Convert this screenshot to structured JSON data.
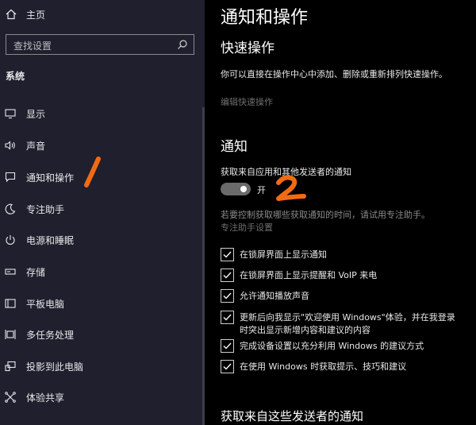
{
  "sidebar": {
    "home_label": "主页",
    "search_placeholder": "查找设置",
    "section_title": "系统",
    "items": [
      {
        "label": "显示",
        "icon": "monitor-icon"
      },
      {
        "label": "声音",
        "icon": "speaker-icon"
      },
      {
        "label": "通知和操作",
        "icon": "notification-icon"
      },
      {
        "label": "专注助手",
        "icon": "moon-icon"
      },
      {
        "label": "电源和睡眠",
        "icon": "power-icon"
      },
      {
        "label": "存储",
        "icon": "storage-icon"
      },
      {
        "label": "平板电脑",
        "icon": "tablet-icon"
      },
      {
        "label": "多任务处理",
        "icon": "multitask-icon"
      },
      {
        "label": "投影到此电脑",
        "icon": "project-icon"
      },
      {
        "label": "体验共享",
        "icon": "share-icon"
      }
    ]
  },
  "main": {
    "title": "通知和操作",
    "quick_actions": {
      "heading": "快速操作",
      "description": "你可以直接在操作中心中添加、删除或重新排列快速操作。",
      "edit_link": "编辑快速操作"
    },
    "notifications": {
      "heading": "通知",
      "label": "获取来自应用和其他发送者的通知",
      "toggle_state": "开",
      "hint": "若要控制获取哪些获取通知的时间，请试用专注助手。",
      "focus_link": "专注助手设置",
      "checkboxes": [
        {
          "label": "在锁屏界面上显示通知",
          "checked": true
        },
        {
          "label": "在锁屏界面上显示提醒和 VoIP 来电",
          "checked": true
        },
        {
          "label": "允许通知播放声音",
          "checked": true
        },
        {
          "label_line1": "更新后向我显示\"欢迎使用 Windows\"体验，并在我登录",
          "label_line2": "时突出显示新增内容和建议的内容",
          "checked": true
        },
        {
          "label": "完成设备设置以充分利用 Windows 的建议方式",
          "checked": true
        },
        {
          "label": "在使用 Windows 时获取提示、技巧和建议",
          "checked": true
        }
      ]
    },
    "senders_heading": "获取来自这些发送者的通知"
  },
  "annotations": {
    "mark1_color": "#f26a13",
    "mark2_color": "#f26a13"
  }
}
